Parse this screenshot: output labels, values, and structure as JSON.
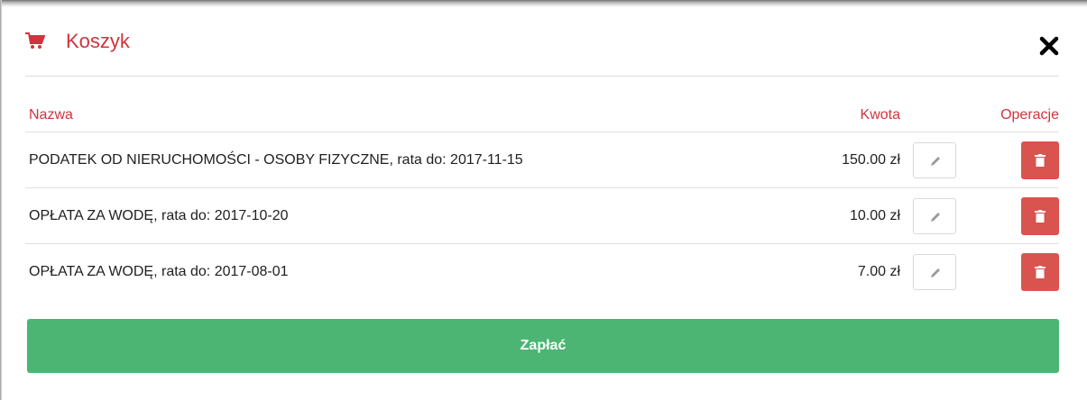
{
  "modal": {
    "title": "Koszyk",
    "title_color": "#d2333d",
    "icons": {
      "cart": "cart-icon",
      "close": "close-icon",
      "edit": "pencil-icon",
      "delete": "trash-icon"
    }
  },
  "table": {
    "headers": {
      "name": "Nazwa",
      "amount": "Kwota",
      "operations": "Operacje"
    },
    "rows": [
      {
        "name": "PODATEK OD NIERUCHOMOŚCI - OSOBY FIZYCZNE, rata do: 2017-11-15",
        "amount": "150.00 zł"
      },
      {
        "name": "OPŁATA ZA WODĘ, rata do: 2017-10-20",
        "amount": "10.00 zł"
      },
      {
        "name": "OPŁATA ZA WODĘ, rata do: 2017-08-01",
        "amount": "7.00 zł"
      }
    ]
  },
  "pay_button": {
    "label": "Zapłać",
    "color": "#4cb573"
  },
  "colors": {
    "accent_red": "#d2333d",
    "delete_red": "#d9534f"
  }
}
